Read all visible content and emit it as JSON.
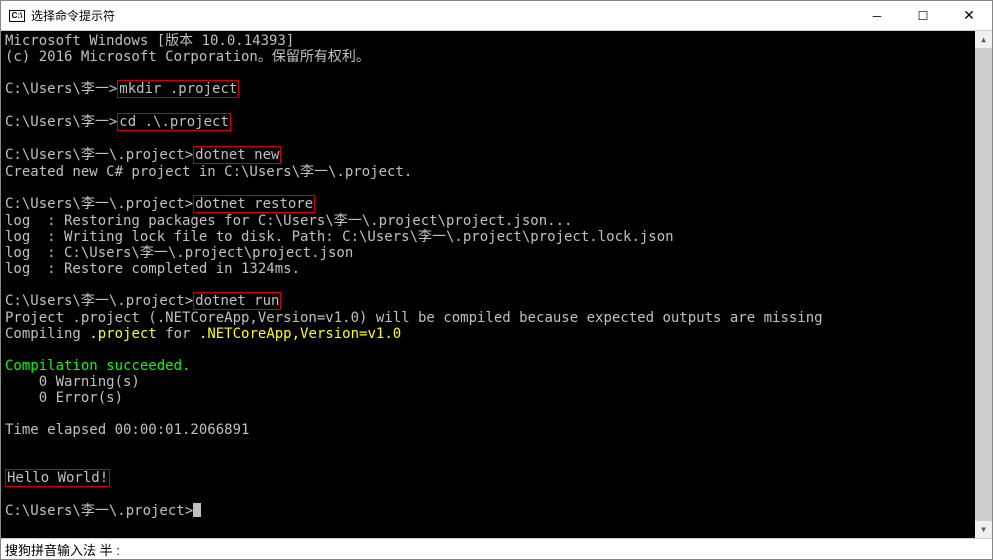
{
  "titlebar": {
    "icon_text": "C:\\",
    "title": "选择命令提示符"
  },
  "terminal": {
    "l1": "Microsoft Windows [版本 10.0.14393]",
    "l2": "(c) 2016 Microsoft Corporation。保留所有权利。",
    "p1": "C:\\Users\\李一>",
    "cmd1": "mkdir .project",
    "p2": "C:\\Users\\李一>",
    "cmd2": "cd .\\.project",
    "p3": "C:\\Users\\李一\\.project>",
    "cmd3": "dotnet new",
    "l_created": "Created new C# project in C:\\Users\\李一\\.project.",
    "p4": "C:\\Users\\李一\\.project>",
    "cmd4": "dotnet restore",
    "log1": "log  : Restoring packages for C:\\Users\\李一\\.project\\project.json...",
    "log2": "log  : Writing lock file to disk. Path: C:\\Users\\李一\\.project\\project.lock.json",
    "log3": "log  : C:\\Users\\李一\\.project\\project.json",
    "log4": "log  : Restore completed in 1324ms.",
    "p5": "C:\\Users\\李一\\.project>",
    "cmd5": "dotnet run",
    "comp_a": "Project .project (.NETCoreApp,Version=v1.0) will be compiled because expected outputs are missing",
    "comp_b_pre": "Compiling ",
    "comp_b_proj": ".project",
    "comp_b_mid": " for ",
    "comp_b_target": ".NETCoreApp,Version=v1.0",
    "succeed": "Compilation succeeded.",
    "warn": "    0 Warning(s)",
    "err": "    0 Error(s)",
    "elapsed": "Time elapsed 00:00:01.2066891",
    "hello": "Hello World!",
    "p6": "C:\\Users\\李一\\.project>"
  },
  "footer": {
    "ime": "搜狗拼音输入法  半  :"
  }
}
